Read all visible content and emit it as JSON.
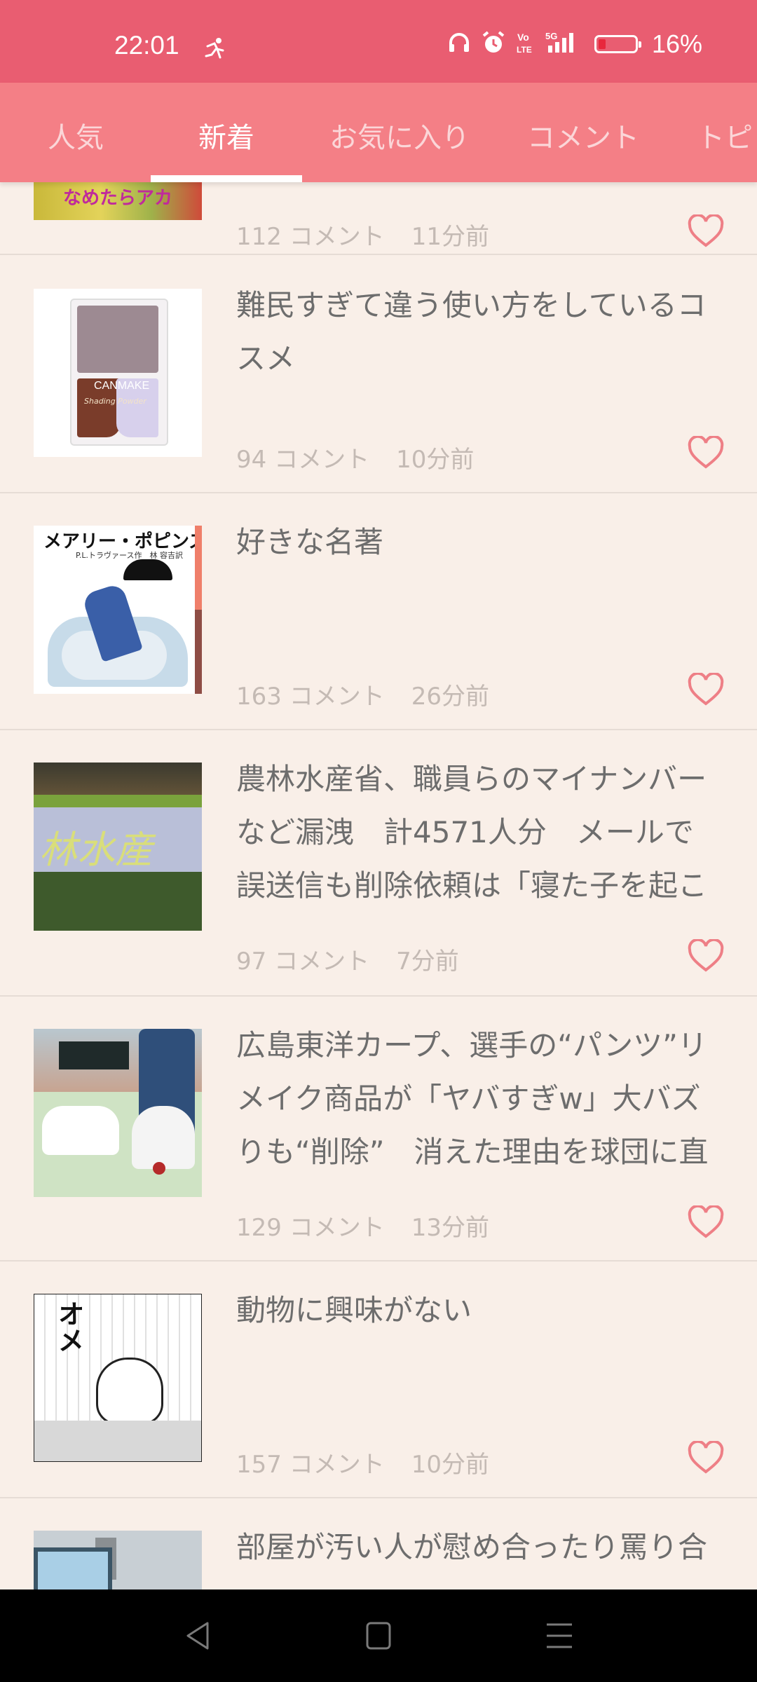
{
  "status": {
    "time": "22:01",
    "network": "5G",
    "volte": "Vo LTE",
    "battery": "16%",
    "battery_level": 0.16
  },
  "tabs": [
    {
      "label": "人気"
    },
    {
      "label": "新着"
    },
    {
      "label": "お気に入り"
    },
    {
      "label": "コメント"
    },
    {
      "label": "トピ"
    }
  ],
  "items": [
    {
      "title": "",
      "thumb_text": "なめたらアカ",
      "comments": "112 コメント",
      "time": "11分前"
    },
    {
      "title": "難民すぎて違う使い方をしているコスメ",
      "thumb_text": "CANMAKE",
      "thumb_sub": "Shading Powder",
      "comments": "94 コメント",
      "time": "10分前"
    },
    {
      "title": "好きな名著",
      "thumb_text": "メアリー・ポピンズ",
      "thumb_sub": "P.L.トラヴァース作　林 容吉訳",
      "comments": "163 コメント",
      "time": "26分前"
    },
    {
      "title": "農林水産省、職員らのマイナンバーなど漏洩　計4571人分　メールで誤送信も削除依頼は「寝た子を起こ",
      "thumb_text": "林水産",
      "comments": "97 コメント",
      "time": "7分前"
    },
    {
      "title": "広島東洋カープ、選手の“パンツ”リメイク商品が「ヤバすぎw」大バズりも“削除”　消えた理由を球団に直",
      "comments": "129 コメント",
      "time": "13分前"
    },
    {
      "title": "動物に興味がない",
      "thumb_text": "オメ",
      "comments": "157 コメント",
      "time": "10分前"
    },
    {
      "title": "部屋が汚い人が慰め合ったり罵り合",
      "comments": "",
      "time": ""
    }
  ]
}
